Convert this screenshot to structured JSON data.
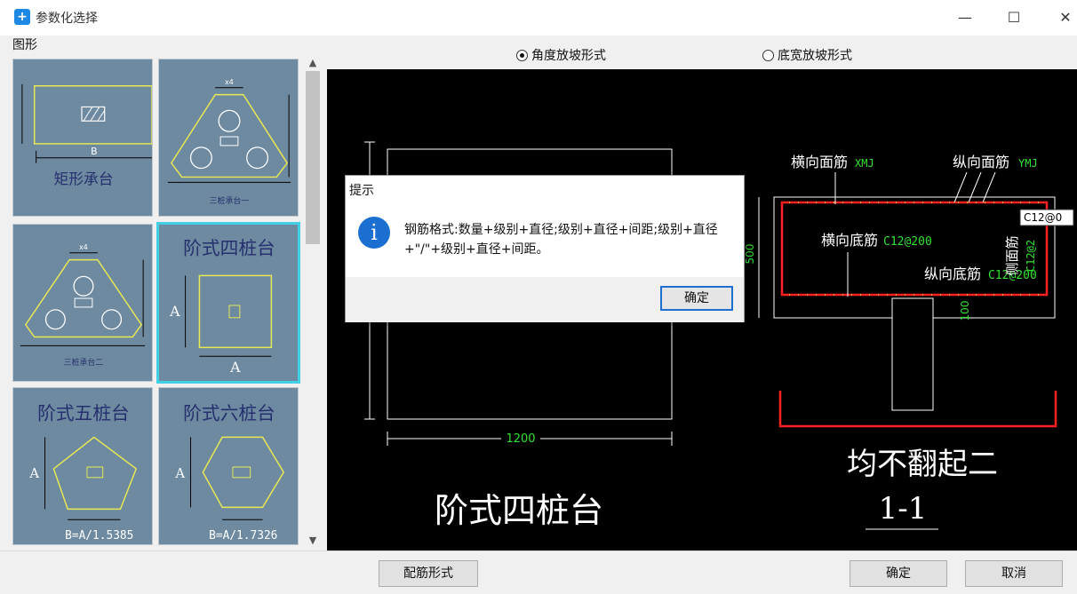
{
  "window": {
    "title": "参数化选择",
    "app_icon": "+",
    "minimize": "—",
    "maximize": "☐",
    "close": "✕"
  },
  "left": {
    "group_label": "图形",
    "thumbs": [
      {
        "label": "矩形承台",
        "dim_b": "B"
      },
      {
        "label": "三桩承台一",
        "dim": "x4"
      },
      {
        "label": "三桩承台二",
        "dim": "x4"
      },
      {
        "label": "阶式四桩台",
        "dim_a": "A"
      },
      {
        "label": "阶式五桩台",
        "dim_a": "A",
        "formula": "B=A/1.5385"
      },
      {
        "label": "阶式六桩台",
        "dim_a": "A",
        "formula": "B=A/1.7326"
      }
    ]
  },
  "right": {
    "radio_angle": "角度放坡形式",
    "radio_width": "底宽放坡形式",
    "cad": {
      "plan_width": "1200",
      "plan_title": "阶式四桩台",
      "label_xmj": "横向面筋",
      "code_xmj": "XMJ",
      "label_ymj": "纵向面筋",
      "code_ymj": "YMJ",
      "label_xdj": "横向底筋",
      "code_xdj": "C12@200",
      "label_ydj": "纵向底筋",
      "code_ydj": "C12@200",
      "side_label": "侧面筋",
      "side_code": "C12@2",
      "height_500": "500",
      "height_100": "100",
      "tooltip": "C12@0",
      "section_note": "均不翻起二",
      "section_name": "1-1"
    }
  },
  "dialog": {
    "title": "提示",
    "icon": "i",
    "message": "钢筋格式:数量+级别+直径;级别+直径+间距;级别+直径+\"/\"+级别+直径+间距。",
    "ok": "确定"
  },
  "bottom": {
    "rebar_button": "配筋形式",
    "ok_button": "确定",
    "cancel_button": "取消"
  }
}
